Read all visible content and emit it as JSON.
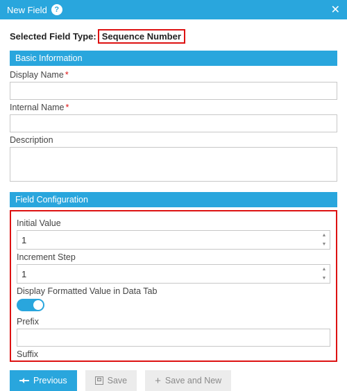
{
  "titlebar": {
    "title": "New Field"
  },
  "selected_type": {
    "label": "Selected Field Type:",
    "value": "Sequence Number"
  },
  "sections": {
    "basic": {
      "header": "Basic Information",
      "display_name": {
        "label": "Display Name",
        "value": ""
      },
      "internal_name": {
        "label": "Internal Name",
        "value": ""
      },
      "description": {
        "label": "Description",
        "value": ""
      }
    },
    "config": {
      "header": "Field Configuration",
      "initial_value": {
        "label": "Initial Value",
        "value": "1"
      },
      "increment_step": {
        "label": "Increment Step",
        "value": "1"
      },
      "formatted_toggle": {
        "label": "Display Formatted Value in Data Tab",
        "on": true
      },
      "prefix": {
        "label": "Prefix",
        "value": ""
      },
      "suffix": {
        "label": "Suffix",
        "value": ""
      }
    }
  },
  "footer": {
    "previous": "Previous",
    "save": "Save",
    "save_and_new": "Save and New"
  },
  "colors": {
    "accent": "#29a6dd",
    "highlight": "#d11"
  }
}
